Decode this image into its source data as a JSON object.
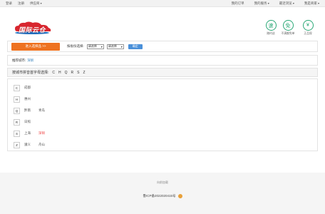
{
  "topbar": {
    "login": "登录",
    "register": "注册",
    "site_nav": "供应商",
    "my_orders": "我的订单",
    "my_service": "我的服务",
    "recent_view": "最近浏览",
    "merchant": "我是商家"
  },
  "header": {
    "logo_text": "国际云仓",
    "services": [
      {
        "icon": "速",
        "label": "随时送"
      },
      {
        "icon": "免",
        "label": "不满额免单"
      },
      {
        "icon": "¥",
        "label": "正品保"
      }
    ]
  },
  "selector": {
    "enter_button": "进入选择品 >>",
    "label": "按省份选择:",
    "province_select": "请选择",
    "city_select": "请选择",
    "confirm_button": "确定"
  },
  "recommend": {
    "label": "推荐城市:",
    "city": "深圳"
  },
  "letters": {
    "label": "按城市拼音首字母选择:",
    "items": [
      "C",
      "H",
      "Q",
      "R",
      "S",
      "Z"
    ]
  },
  "city_groups": [
    {
      "letter": "C",
      "cities": [
        "成都"
      ]
    },
    {
      "letter": "H",
      "cities": [
        "惠州"
      ]
    },
    {
      "letter": "Q",
      "cities": [
        "黔南",
        "青岛"
      ]
    },
    {
      "letter": "R",
      "cities": [
        "日照"
      ]
    },
    {
      "letter": "S",
      "cities": [
        "上海",
        "深圳"
      ]
    },
    {
      "letter": "Z",
      "cities": [
        "遵义",
        "舟山"
      ]
    }
  ],
  "active_city": "深圳",
  "footer": {
    "about": "向前加载",
    "icp": "鲁ICP备2022020415号"
  },
  "colors": {
    "accent_orange": "#ee7220",
    "accent_green": "#2aa876",
    "link_blue": "#2a7ab8",
    "active_red": "#e33333"
  }
}
